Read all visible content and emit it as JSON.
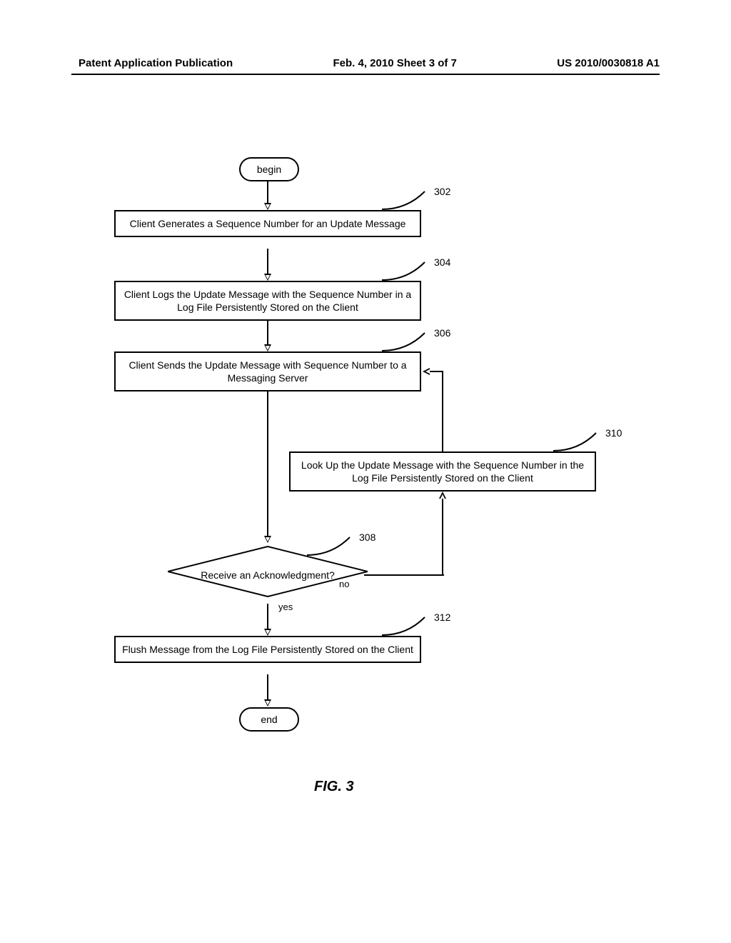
{
  "header": {
    "left": "Patent Application Publication",
    "center": "Feb. 4, 2010  Sheet 3 of 7",
    "right": "US 2010/0030818 A1"
  },
  "flowchart": {
    "begin": "begin",
    "end": "end",
    "step302": "Client Generates a Sequence Number for an Update Message",
    "step304": "Client Logs  the Update Message with the Sequence Number in a Log File Persistently Stored on the Client",
    "step306": "Client Sends the Update Message with Sequence Number to a Messaging Server",
    "step308": "Receive an Acknowledgment?",
    "step310": "Look Up the Update Message with the Sequence Number in the Log File Persistently Stored on the Client",
    "step312": "Flush Message from the Log File Persistently Stored on the Client",
    "callout302": "302",
    "callout304": "304",
    "callout306": "306",
    "callout308": "308",
    "callout310": "310",
    "callout312": "312",
    "label_no": "no",
    "label_yes": "yes"
  },
  "figure_label": "FIG. 3"
}
